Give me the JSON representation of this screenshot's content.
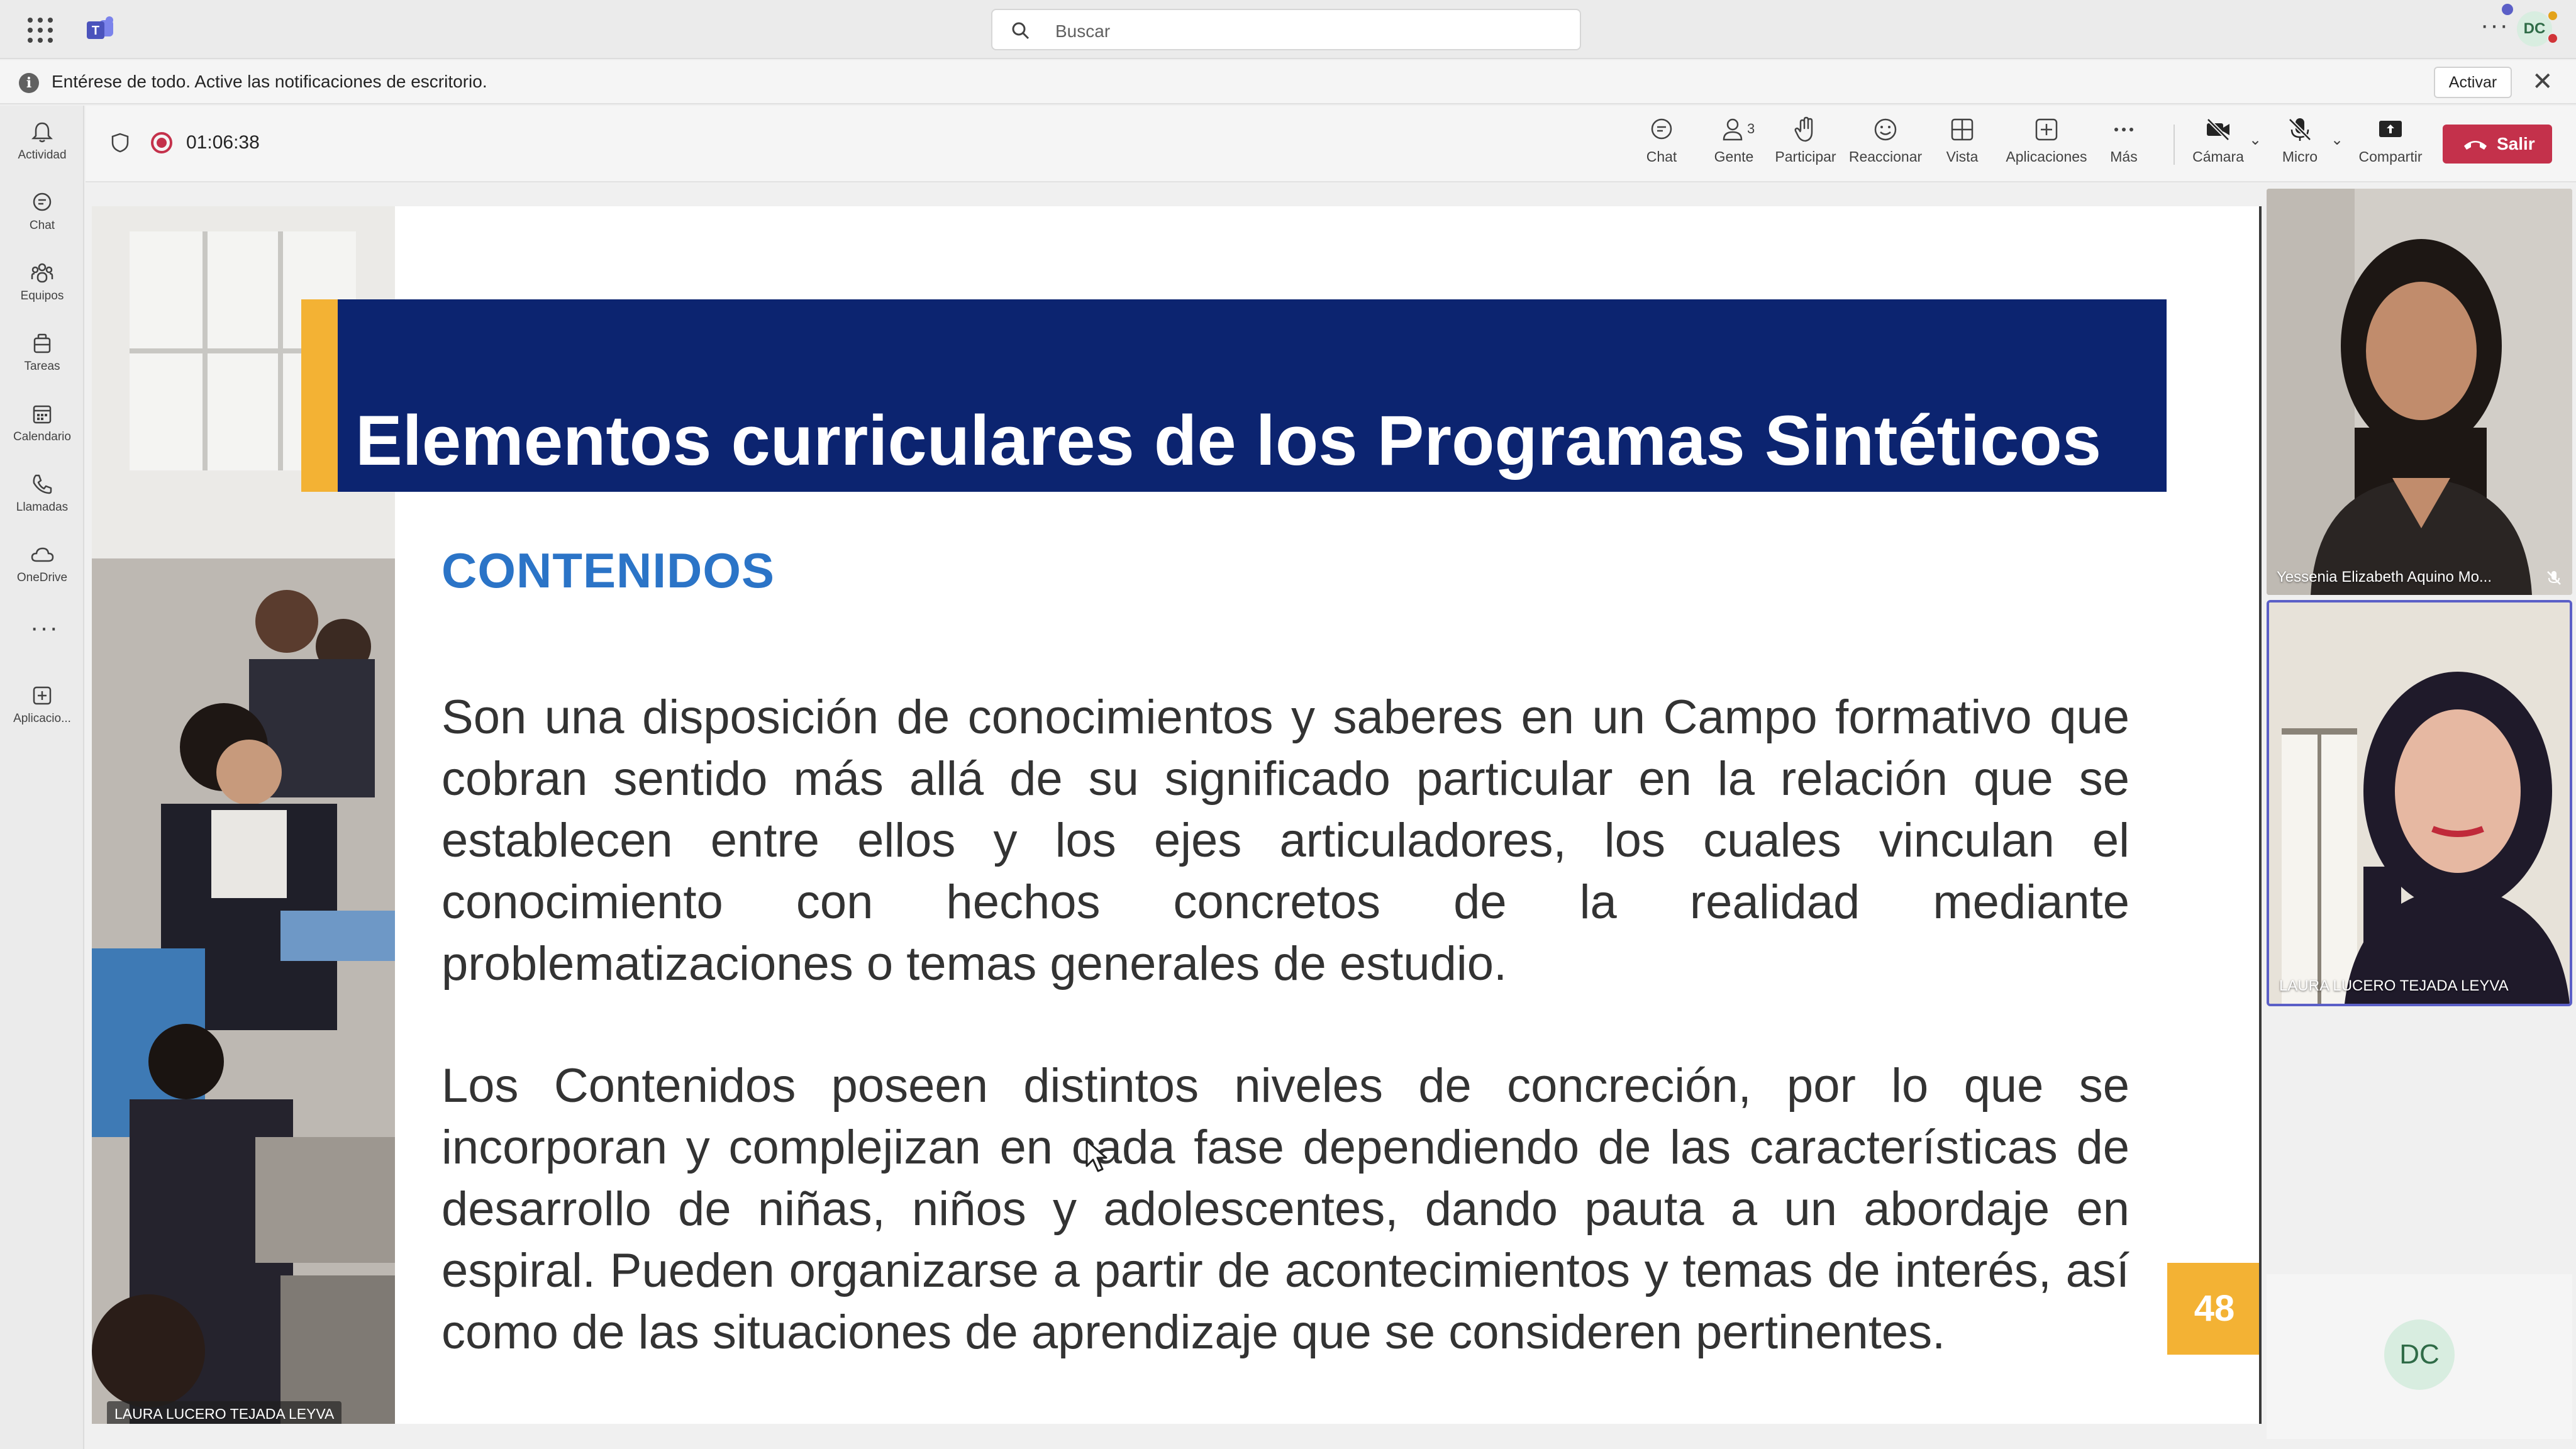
{
  "titlebar": {
    "search_placeholder": "Buscar",
    "avatar_initials": "DC"
  },
  "notification": {
    "message": "Entérese de todo. Active las notificaciones de escritorio.",
    "activate_label": "Activar"
  },
  "rail": {
    "items": [
      {
        "label": "Actividad",
        "icon": "bell-icon"
      },
      {
        "label": "Chat",
        "icon": "chat-icon"
      },
      {
        "label": "Equipos",
        "icon": "teams-icon"
      },
      {
        "label": "Tareas",
        "icon": "tasks-icon"
      },
      {
        "label": "Calendario",
        "icon": "calendar-icon"
      },
      {
        "label": "Llamadas",
        "icon": "phone-icon"
      },
      {
        "label": "OneDrive",
        "icon": "cloud-icon"
      },
      {
        "label": "Aplicacio...",
        "icon": "add-app-icon"
      }
    ]
  },
  "meeting": {
    "timer": "01:06:38",
    "people_count": "3",
    "tools": {
      "chat": "Chat",
      "people": "Gente",
      "raise": "Participar",
      "react": "Reaccionar",
      "view": "Vista",
      "apps": "Aplicaciones",
      "more": "Más",
      "camera": "Cámara",
      "mic": "Micro",
      "share": "Compartir"
    },
    "leave_label": "Salir"
  },
  "slide": {
    "title": "Elementos curriculares de los Programas Sintéticos",
    "subtitle": "CONTENIDOS",
    "paragraph1": "Son una disposición de conocimientos y saberes en un Campo formativo que cobran sentido más allá de su significado particular en la relación que se establecen entre ellos y los ejes articuladores, los cuales vinculan el conocimiento con hechos concretos de la realidad mediante problematizaciones o temas generales de estudio.",
    "paragraph2": "Los Contenidos poseen distintos niveles de concreción, por lo que se incorporan y complejizan en cada fase dependiendo de las características de desarrollo de niñas, niños y adolescentes, dando pauta a un abordaje en espiral. Pueden organizarse a partir de acontecimientos y temas de interés, así como de las situaciones de aprendizaje que se consideren pertinentes.",
    "page_number": "48",
    "presenter": "LAURA LUCERO TEJADA LEYVA"
  },
  "participants": [
    {
      "name": "Yessenia Elizabeth Aquino Mo...",
      "muted": true
    },
    {
      "name": "LAURA LUCERO TEJADA LEYVA",
      "speaking": true
    },
    {
      "initials": "DC"
    }
  ],
  "colors": {
    "banner": "#0c2470",
    "accent": "#f3b234",
    "subtitle": "#2b74c7",
    "leave": "#c4314b"
  }
}
